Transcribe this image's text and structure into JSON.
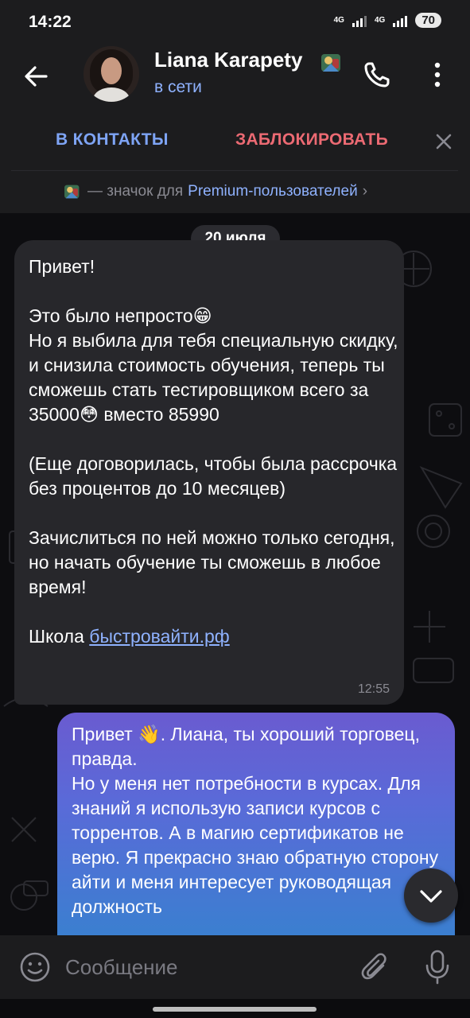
{
  "status_bar": {
    "time": "14:22",
    "network1": "4G",
    "network2": "4G",
    "battery": "70"
  },
  "header": {
    "contact_name": "Liana Karapety",
    "contact_status": "в сети"
  },
  "action_bar": {
    "add_contact": "В КОНТАКТЫ",
    "block": "ЗАБЛОКИРОВАТЬ",
    "premium_prefix": "— значок для",
    "premium_link": "Premium-пользователей",
    "premium_chevron": "›"
  },
  "chat": {
    "date": "20 июля",
    "incoming": {
      "text": "Привет!\n\nЭто было непросто😁\nНо я выбила для тебя специальную скидку, и снизила стоимость обучения, теперь ты сможешь стать тестировщиком всего за 35000😳 вместо 85990\n\n(Еще договорилась, чтобы была рассрочка без процентов до 10 месяцев)\n\nЗачислиться по ней можно только сегодня, но начать обучение ты сможешь в любое время!\n\n",
      "link_prefix": "Школа ",
      "link": "быстровайти.рф",
      "time": "12:55"
    },
    "outgoing": {
      "text": "Привет 👋. Лиана, ты хороший торговец, правда.\nНо у меня нет потребности в курсах. Для знаний я использую записи курсов с торрентов. А в магию сертификатов не верю. Я прекрасно знаю обратную сторону айти и меня интересует руководящая должность"
    }
  },
  "input": {
    "placeholder": "Сообщение"
  },
  "colors": {
    "accent": "#8fb2ff",
    "danger": "#ec6a73",
    "bubble_in": "#27272b",
    "bubble_out_top": "#6a5bd0",
    "bubble_out_bottom": "#3b7fd0"
  }
}
